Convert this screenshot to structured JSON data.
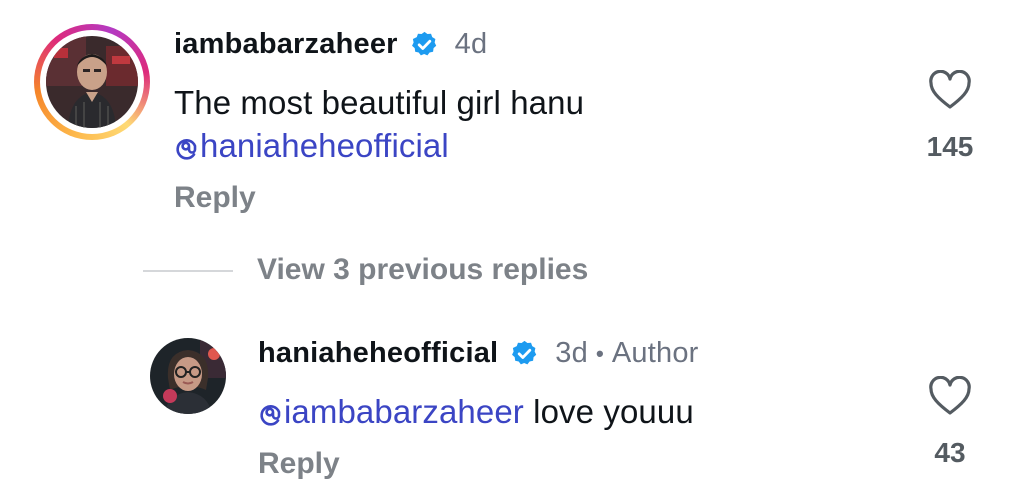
{
  "comments": [
    {
      "username": "iambabarzaheer",
      "verified": true,
      "time": "4d",
      "text": "The most beautiful girl hanu",
      "mention": "haniaheheofficial",
      "reply_label": "Reply",
      "likes": "145",
      "story_ring": true
    },
    {
      "username": "haniaheheofficial",
      "verified": true,
      "time": "3d",
      "separator": "•",
      "badge": "Author",
      "mention": "iambabarzaheer",
      "text": " love youuu",
      "reply_label": "Reply",
      "likes": "43"
    }
  ],
  "view_replies_label": "View 3 previous replies",
  "colors": {
    "mention": "#3b45c4",
    "verified": "#1d9bf0",
    "muted": "#7d8288"
  },
  "icons": [
    "verified-badge-icon",
    "heart-icon",
    "mention-at-icon"
  ]
}
